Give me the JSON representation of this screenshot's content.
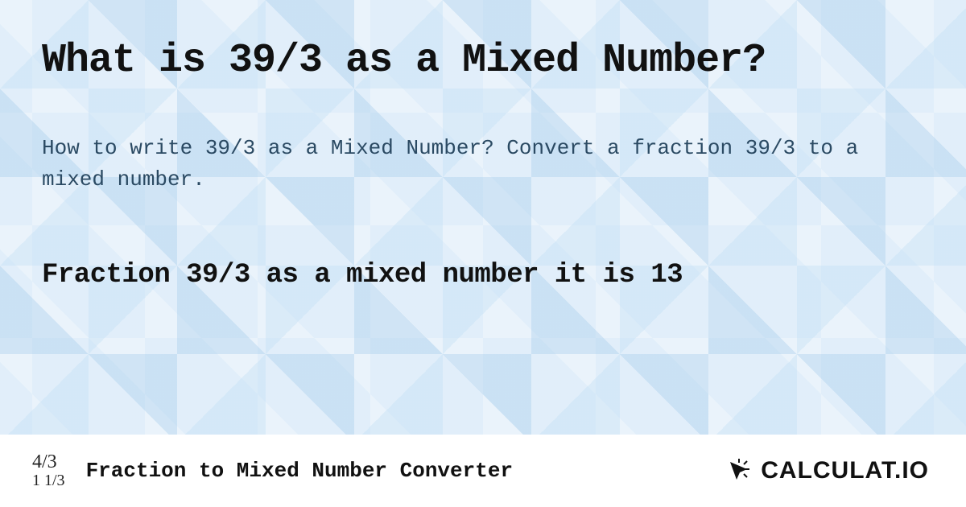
{
  "title": "What is 39/3 as a Mixed Number?",
  "lead": "How to write 39/3 as a Mixed Number? Convert a fraction 39/3 to a mixed number.",
  "answer": "Fraction 39/3 as a mixed number it is 13",
  "footer": {
    "frac_top": "4/3",
    "frac_bot": "1 1/3",
    "converter_title": "Fraction to Mixed Number Converter"
  },
  "brand": {
    "name": "CALCULAT.IO"
  }
}
